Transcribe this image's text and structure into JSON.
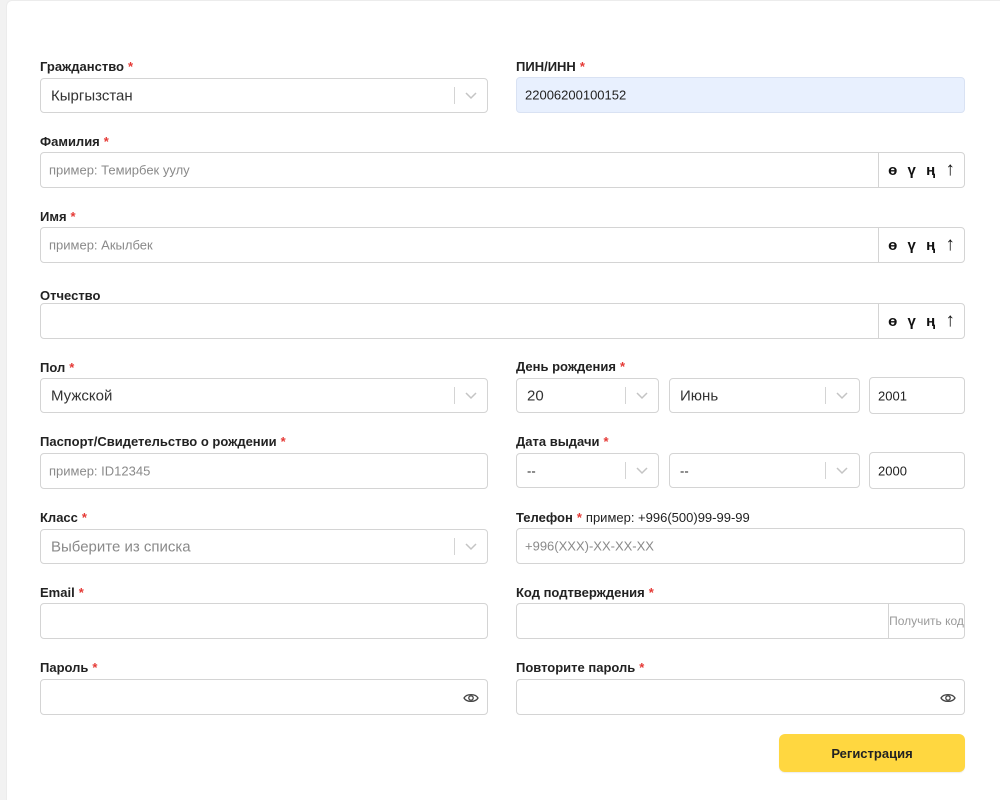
{
  "form": {
    "citizenship": {
      "label": "Гражданство",
      "value": "Кыргызстан"
    },
    "pin": {
      "label": "ПИН/ИНН",
      "value": "22006200100152"
    },
    "surname": {
      "label": "Фамилия",
      "placeholder": "пример: Темирбек уулу"
    },
    "name": {
      "label": "Имя",
      "placeholder": "пример: Акылбек"
    },
    "patronymic": {
      "label": "Отчество",
      "placeholder": ""
    },
    "special_keys": [
      "ө",
      "ү",
      "ң",
      "↑"
    ],
    "gender": {
      "label": "Пол",
      "value": "Мужской"
    },
    "birthday": {
      "label": "День рождения",
      "day": "20",
      "month": "Июнь",
      "year": "2001"
    },
    "passport": {
      "label": "Паспорт/Свидетельство о рождении",
      "placeholder": "пример: ID12345"
    },
    "issue_date": {
      "label": "Дата выдачи",
      "day": "--",
      "month": "--",
      "year": "2000"
    },
    "grade": {
      "label": "Класс",
      "placeholder": "Выберите из списка"
    },
    "phone": {
      "label": "Телефон",
      "hint": "пример: +996(500)99-99-99",
      "placeholder": "+996(XXX)-XX-XX-XX"
    },
    "email": {
      "label": "Email",
      "value": ""
    },
    "code": {
      "label": "Код подтверждения",
      "get_code_label": "Получить код"
    },
    "password": {
      "label": "Пароль",
      "value": ""
    },
    "password_repeat": {
      "label": "Повторите пароль",
      "value": ""
    },
    "required_mark": "*",
    "submit_label": "Регистрация"
  },
  "colors": {
    "required": "#e53935",
    "submit": "#ffd740",
    "autofill": "#e8f0fe"
  }
}
